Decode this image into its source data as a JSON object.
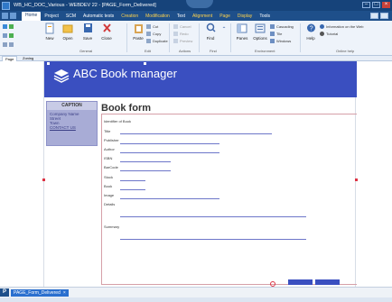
{
  "window": {
    "title": "WB_HC_DOC_Various - WEBDEV 22 - [PAGE_Form_Delivered]"
  },
  "menu": {
    "items": [
      "Home",
      "Project",
      "SCM",
      "Automatic tests",
      "Creation",
      "Modification",
      "Text",
      "Alignment",
      "Page",
      "Display",
      "Tools"
    ],
    "active": "Home"
  },
  "ribbon": {
    "buttons": {
      "new": "New",
      "open": "Open",
      "save": "Save",
      "close": "Close",
      "paste": "Paste",
      "find": "Find",
      "panes": "Panes",
      "options": "Options",
      "help": "Help"
    },
    "small": {
      "cut": "Cut",
      "copy": "Copy",
      "duplicate": "Duplicate",
      "undo": "Cancel",
      "redo": "Redo",
      "preview": "Preview",
      "cascading": "Cascading",
      "tile": "Tile",
      "windows": "Windows",
      "info": "Information on the Web",
      "tutorial": "Tutorial"
    },
    "groups": {
      "general": "General",
      "edit": "Edit",
      "actions": "Actions",
      "find": "Find",
      "environment": "Environment",
      "online_help": "Online help"
    }
  },
  "doc_tabs": {
    "page": "Page",
    "zoning": "Zoning"
  },
  "page": {
    "banner_title": "ABC Book manager",
    "sidebar": {
      "caption": "CAPTION",
      "links": [
        "Company Name",
        "Street",
        "Town",
        "CONTACT US"
      ]
    },
    "form_title": "Book form",
    "form_fields": [
      "Identifier of Book",
      "Title",
      "Publisher",
      "Author",
      "ISBN",
      "BarCode",
      "Stock",
      "Book",
      "Image",
      "Details",
      "Summary"
    ]
  },
  "status": {
    "p_label": "P",
    "tab_label": "PAGE_Form_Delivered",
    "tab_close": "×"
  },
  "colors": {
    "titlebar": "#16437a",
    "banner": "#3a4fc0",
    "sidebar": "#a8acd6",
    "field_line": "#6d76c9"
  }
}
